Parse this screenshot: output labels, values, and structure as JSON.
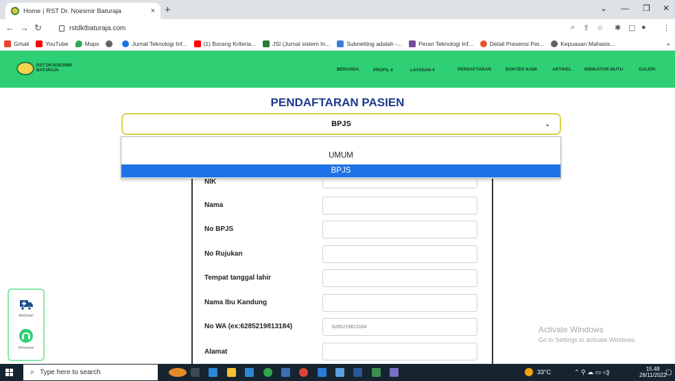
{
  "browser": {
    "tab_title": "Home | RST Dr. Noesmir Baturaja",
    "tab_close": "×",
    "new_tab": "+",
    "url": "rstdktbaturaja.com",
    "bookmarks": [
      {
        "label": "Gmail",
        "color": "#ea4335"
      },
      {
        "label": "YouTube",
        "color": "#ff0000"
      },
      {
        "label": "Maps",
        "color": "#34a853"
      },
      {
        "label": "",
        "color": "#5f6368"
      },
      {
        "label": "Jurnal Teknologi Inf...",
        "color": "#1a73e8"
      },
      {
        "label": "(1) Borang Kriteria...",
        "color": "#ff0000"
      },
      {
        "label": "JSI (Jurnal sistem In...",
        "color": "#2a7a3a"
      },
      {
        "label": "Subnetting adalah -...",
        "color": "#3b7ddd"
      },
      {
        "label": "Peran Teknologi Inf...",
        "color": "#7a4b9c"
      },
      {
        "label": "Detail Presensi Per...",
        "color": "#e8572a"
      },
      {
        "label": "Kepuasan Mahasis...",
        "color": "#5f6368"
      }
    ],
    "bookmarks_more": "»"
  },
  "site": {
    "logo_line1": "RST DR.NOESMIR",
    "logo_line2": "BATURAJA",
    "menu": [
      {
        "label": "BERANDA"
      },
      {
        "label": "PROFIL ▾"
      },
      {
        "label": "LAYANAN ▾"
      },
      {
        "label": "PENDAFTARAN"
      },
      {
        "label": "DOKTER KAMI"
      },
      {
        "label": "ARTIKEL"
      },
      {
        "label": "INDIKATOR MUTU"
      },
      {
        "label": "GALERI"
      }
    ],
    "accent_color": "#2fcf74"
  },
  "main": {
    "heading": "PENDAFTARAN PASIEN",
    "select_value": "BPJS",
    "options": [
      "UMUM",
      "BPJS"
    ],
    "selected_option": "BPJS",
    "fields": [
      {
        "label": "NIK",
        "value": ""
      },
      {
        "label": "Nama",
        "value": ""
      },
      {
        "label": "No BPJS",
        "value": ""
      },
      {
        "label": "No Rujukan",
        "value": ""
      },
      {
        "label": "Tempat tanggal lahir",
        "value": ""
      },
      {
        "label": "Nama Ibu Kandung",
        "value": ""
      },
      {
        "label": "No WA (ex:6285219813184)",
        "value": "6285219813184"
      },
      {
        "label": "Alamat",
        "value": ""
      }
    ]
  },
  "widgets": {
    "ambulance_label": "Ambulan",
    "info_label": "Informasi"
  },
  "watermark": {
    "title": "Activate Windows",
    "subtitle": "Go to Settings to activate Windows."
  },
  "taskbar": {
    "search_placeholder": "Type here to search",
    "temperature": "33°C",
    "time": "15.48",
    "date": "28/11/2022"
  }
}
